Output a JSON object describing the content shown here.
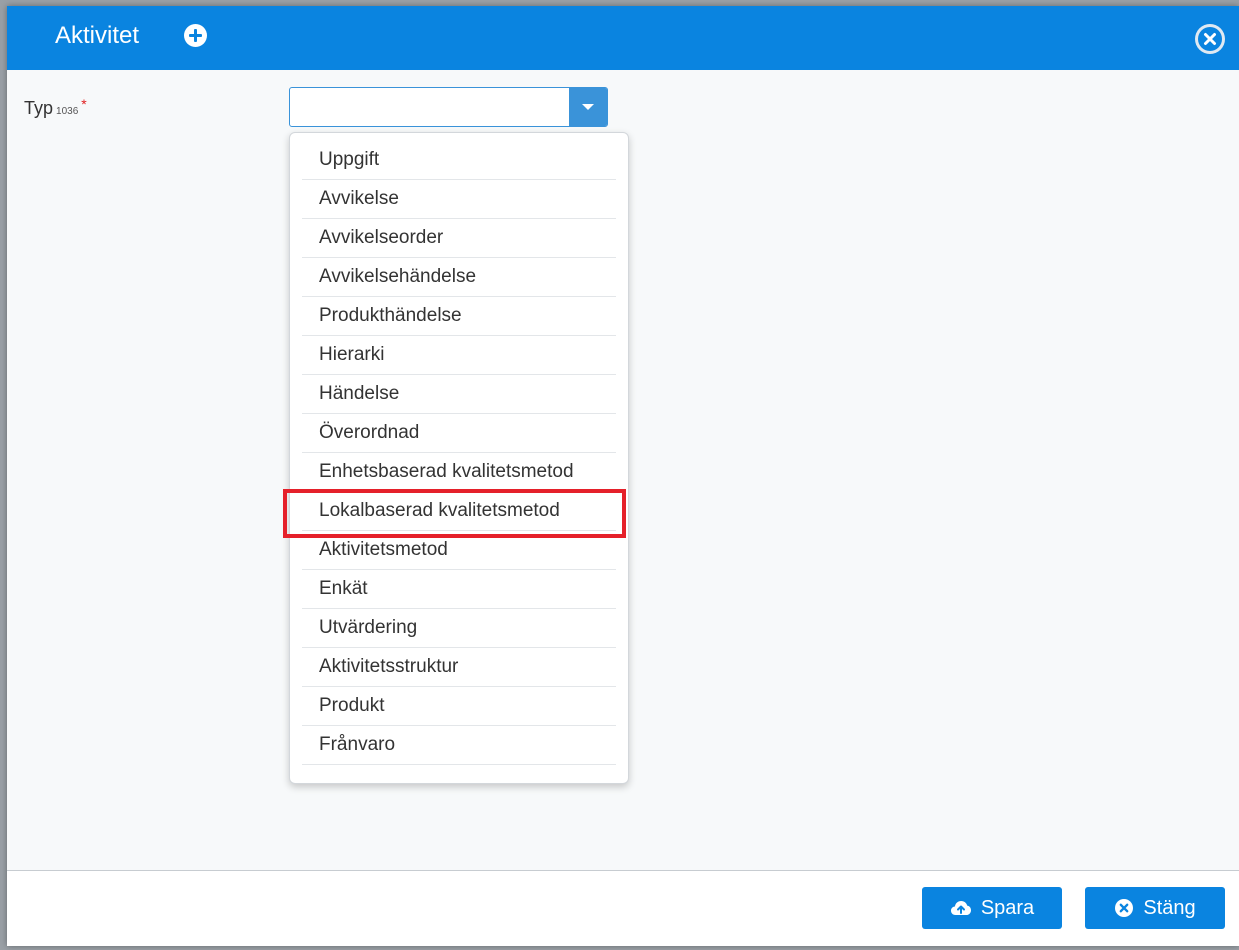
{
  "modal": {
    "title": "Aktivitet",
    "add_icon": "plus-circle-icon",
    "close_icon": "x-circle-icon"
  },
  "form": {
    "type_field": {
      "label": "Typ",
      "code": "1036",
      "required_mark": "*",
      "value": ""
    }
  },
  "dropdown": {
    "options": [
      "Uppgift",
      "Avvikelse",
      "Avvikelseorder",
      "Avvikelsehändelse",
      "Produkthändelse",
      "Hierarki",
      "Händelse",
      "Överordnad",
      "Enhetsbaserad kvalitetsmetod",
      "Lokalbaserad kvalitetsmetod",
      "Aktivitetsmetod",
      "Enkät",
      "Utvärdering",
      "Aktivitetsstruktur",
      "Produkt",
      "Frånvaro"
    ],
    "highlighted_option": "Lokalbaserad kvalitetsmetod"
  },
  "footer": {
    "save_label": "Spara",
    "save_icon": "cloud-upload-icon",
    "close_label": "Stäng",
    "close_icon": "x-circle-icon"
  },
  "colors": {
    "header": "#0a84e0",
    "accent": "#3a93d9",
    "highlight": "#e5202a"
  }
}
